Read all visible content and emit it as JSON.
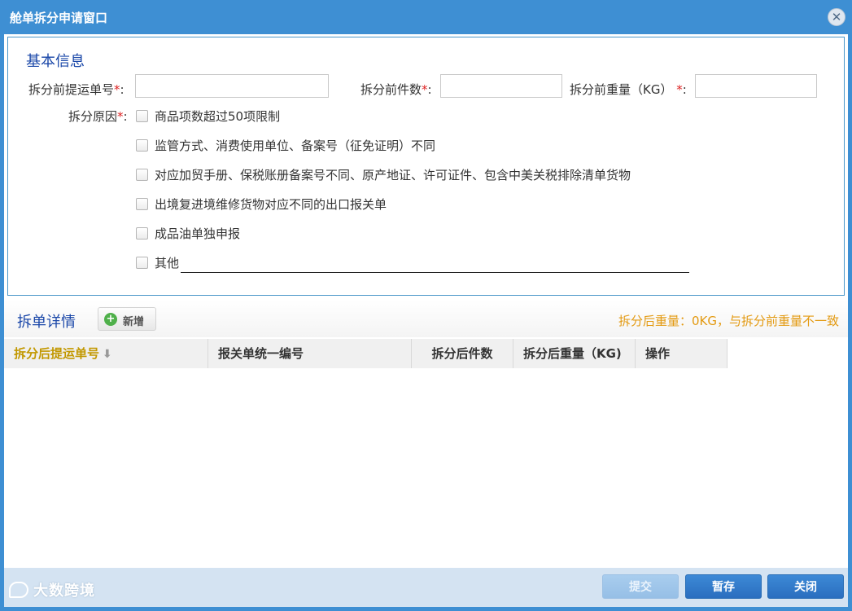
{
  "window": {
    "title": "舱单拆分申请窗口",
    "close_icon": "close-icon"
  },
  "basic_info": {
    "section_title": "基本信息",
    "fields": {
      "bill_no_label": "拆分前提运单号",
      "pieces_label": "拆分前件数",
      "weight_label": "拆分前重量（KG）",
      "required_mark": "*",
      "colon": ":"
    },
    "values": {
      "bill_no": "",
      "pieces": "",
      "weight": ""
    },
    "reason_label": "拆分原因",
    "reasons": [
      "商品项数超过50项限制",
      "监管方式、消费使用单位、备案号（征免证明）不同",
      "对应加贸手册、保税账册备案号不同、原产地证、许可证件、包含中美关税排除清单货物",
      "出境复进境维修货物对应不同的出口报关单",
      "成品油单独申报",
      "其他"
    ]
  },
  "detail": {
    "section_title": "拆单详情",
    "add_label": "新增",
    "add_icon": "plus-circle-icon",
    "warning": "拆分后重量：0KG，与拆分前重量不一致",
    "columns": [
      "拆分后提运单号",
      "报关单统一编号",
      "拆分后件数",
      "拆分后重量（KG)",
      "操作"
    ],
    "sort_icon": "sort-down-icon",
    "rows": []
  },
  "footer": {
    "logo_text": "大数跨境",
    "buttons": {
      "submit": "提交",
      "save_draft": "暂存",
      "close": "关闭"
    }
  },
  "colors": {
    "title_bar": "#3e8fd3",
    "section_title": "#1a47a8",
    "warning": "#e39a12",
    "sorted_column": "#c29800",
    "primary_button": "#2a6ebf"
  }
}
